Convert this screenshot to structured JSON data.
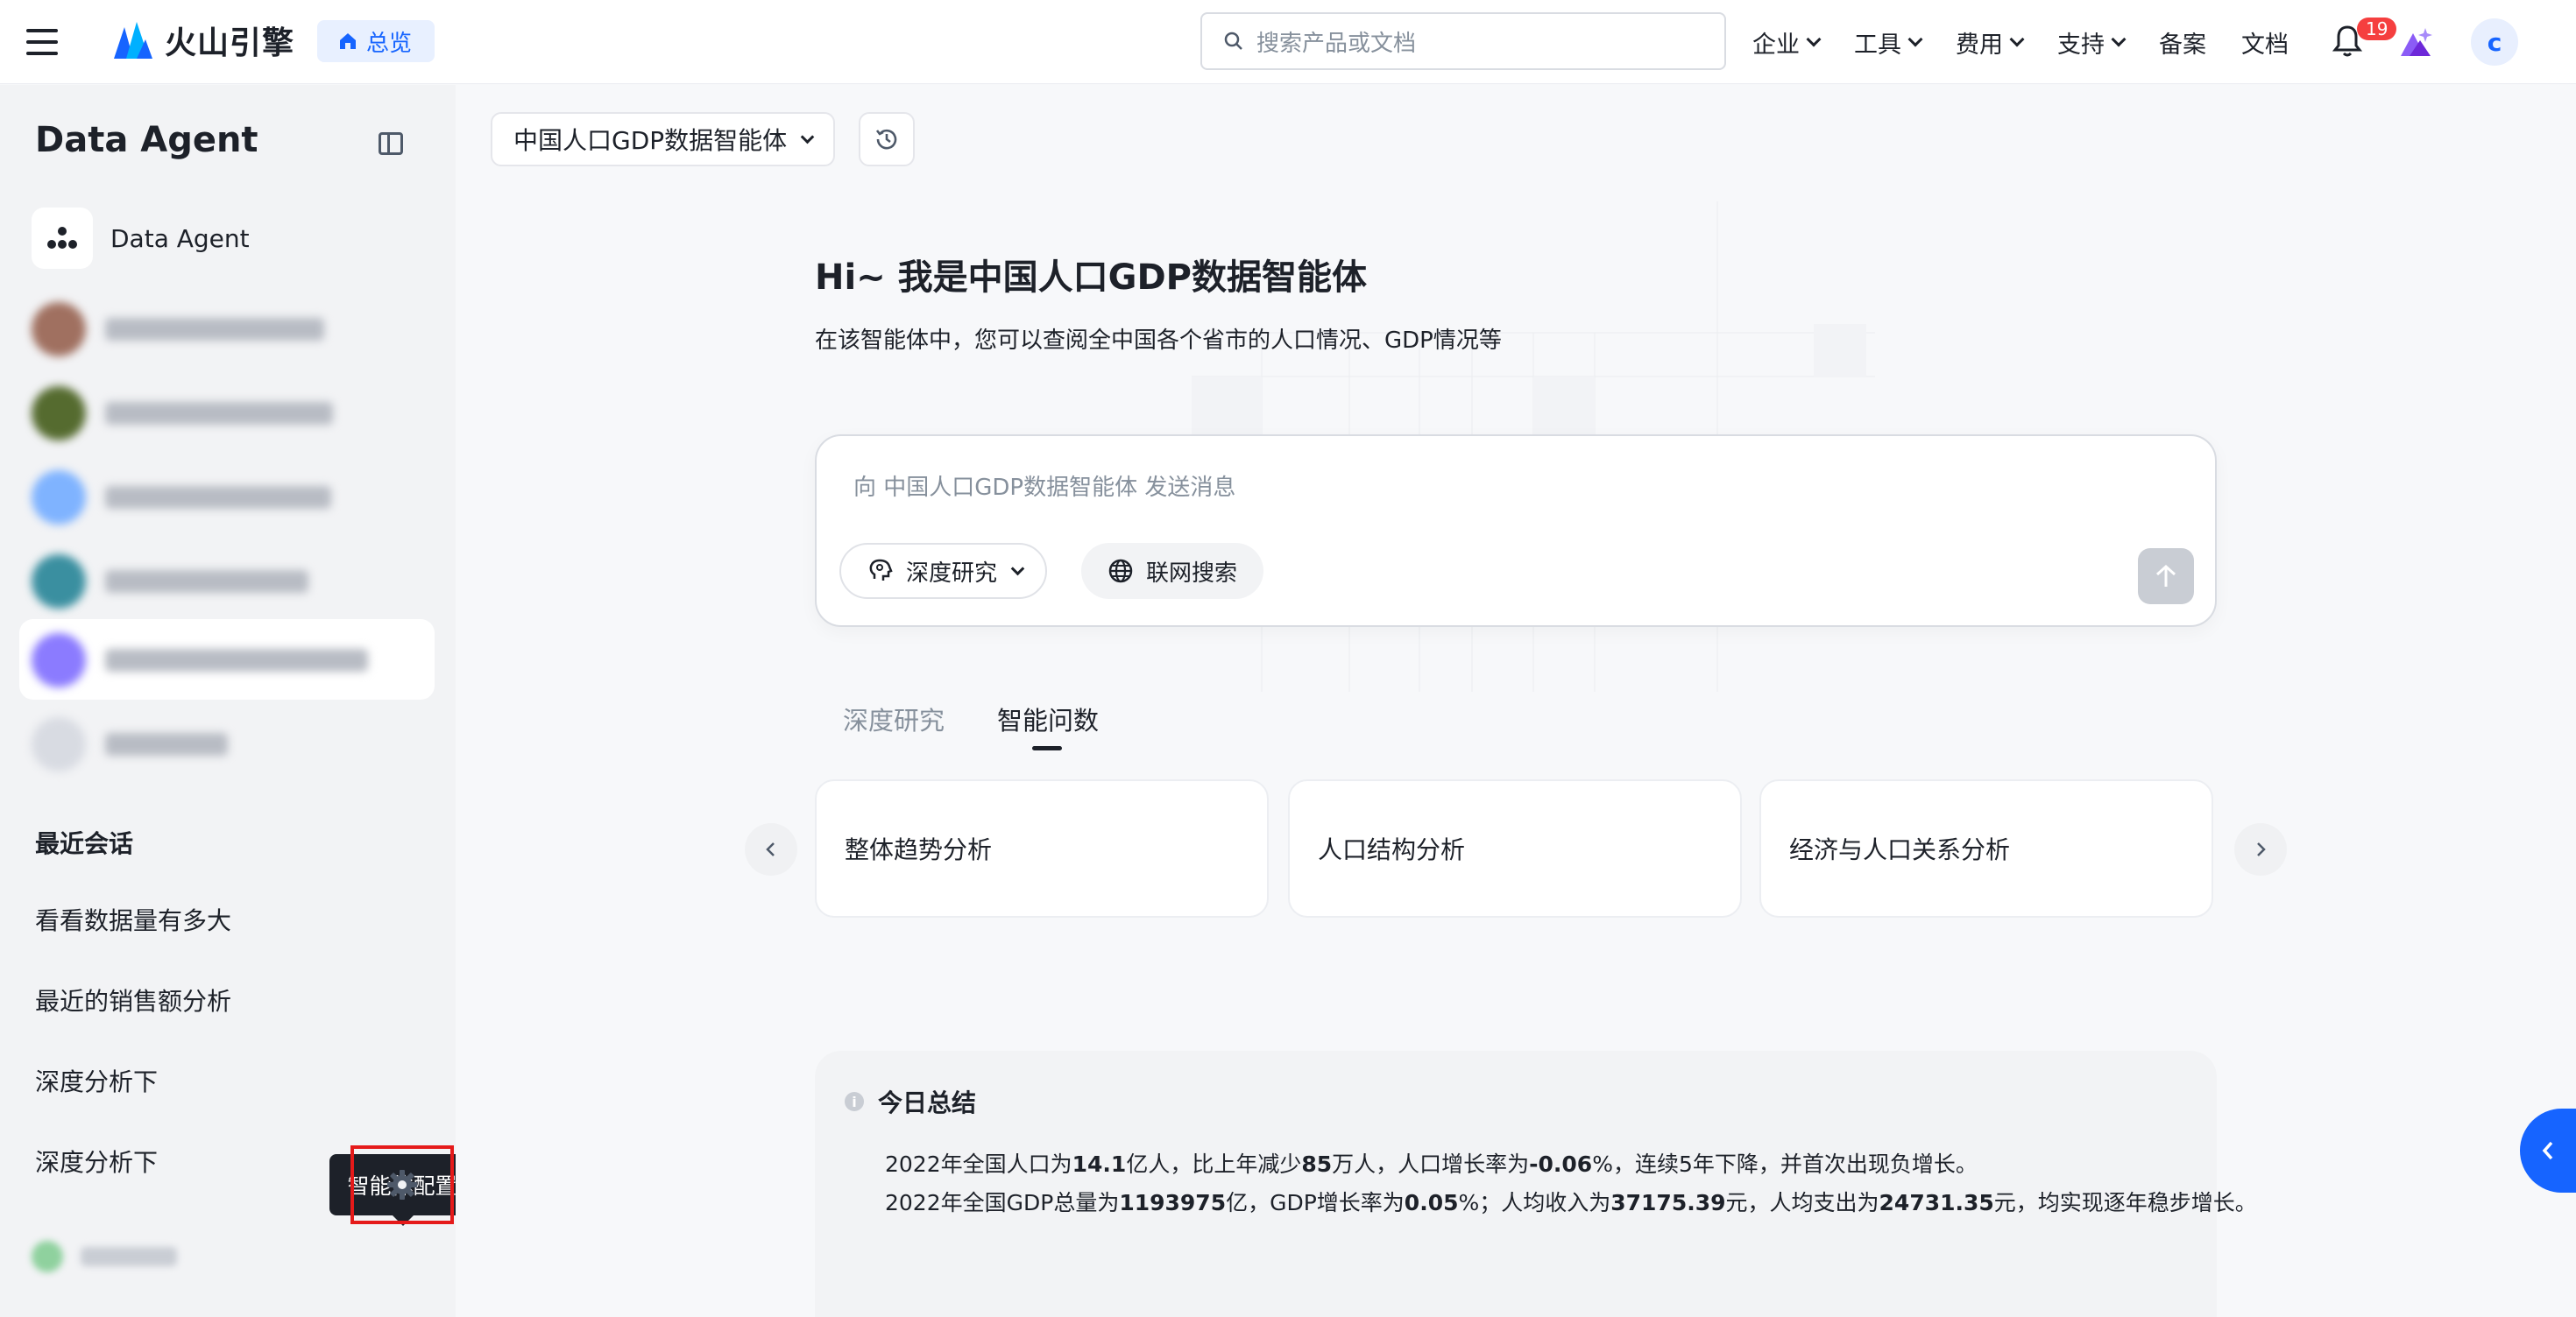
{
  "topbar": {
    "brand": "火山引擎",
    "overview_label": "总览",
    "search_placeholder": "搜索产品或文档",
    "nav": [
      {
        "label": "企业",
        "dropdown": true
      },
      {
        "label": "工具",
        "dropdown": true
      },
      {
        "label": "费用",
        "dropdown": true
      },
      {
        "label": "支持",
        "dropdown": true
      },
      {
        "label": "备案",
        "dropdown": false
      },
      {
        "label": "文档",
        "dropdown": false
      }
    ],
    "notification_count": "19",
    "avatar_letter": "c"
  },
  "sidebar": {
    "title": "Data Agent",
    "primary_agent": "Data Agent",
    "recent_title": "最近会话",
    "recent": [
      "看看数据量有多大",
      "最近的销售额分析",
      "深度分析下",
      "深度分析下"
    ],
    "tooltip": "智能体配置"
  },
  "main": {
    "agent_selector": "中国人口GDP数据智能体",
    "hero_title": "Hi~ 我是中国人口GDP数据智能体",
    "hero_subtitle": "在该智能体中，您可以查阅全中国各个省市的人口情况、GDP情况等",
    "chat_placeholder": "向 中国人口GDP数据智能体 发送消息",
    "chip_deep_research": "深度研究",
    "chip_web_search": "联网搜索",
    "tabs": [
      {
        "label": "深度研究",
        "active": false
      },
      {
        "label": "智能问数",
        "active": true
      }
    ],
    "cards": [
      "整体趋势分析",
      "人口结构分析",
      "经济与人口关系分析"
    ],
    "summary": {
      "title": "今日总结",
      "line1": {
        "p1": "2022年全国人口为",
        "v1": "14.1",
        "p2": "亿人，比上年减少",
        "v2": "85",
        "p3": "万人，人口增长率为",
        "v3": "-0.06",
        "p4": "%，连续5年下降，并首次出现负增长。"
      },
      "line2": {
        "p1": "2022年全国GDP总量为",
        "v1": "1193975",
        "p2": "亿，GDP增长率为",
        "v2": "0.05",
        "p3": "%；人均收入为",
        "v3": "37175.39",
        "p4": "元，人均支出为",
        "v4": "24731.35",
        "p5": "元，均实现逐年稳步增长。"
      }
    }
  },
  "colors": {
    "accent": "#1664ff",
    "badge": "#f53f3f",
    "highlight_box": "#e51a1a"
  }
}
